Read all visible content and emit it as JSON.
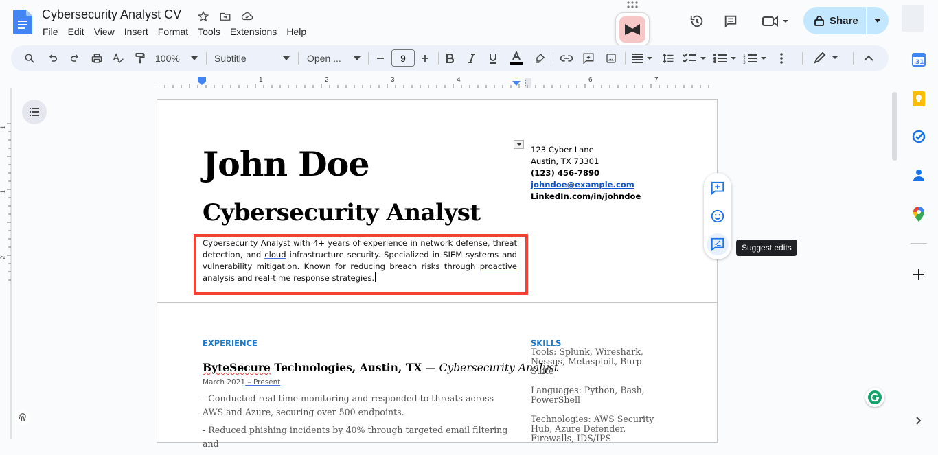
{
  "doc": {
    "title": "Cybersecurity Analyst CV",
    "menu": [
      "File",
      "Edit",
      "View",
      "Insert",
      "Format",
      "Tools",
      "Extensions",
      "Help"
    ]
  },
  "header": {
    "share_label": "Share"
  },
  "toolbar": {
    "zoom": "100%",
    "style": "Subtitle",
    "font": "Open ...",
    "font_size": "9"
  },
  "ruler": {
    "numbers": [
      "1",
      "2",
      "3",
      "4",
      "5",
      "6",
      "7"
    ]
  },
  "vruler": {
    "numbers": [
      "1",
      "1",
      "2"
    ]
  },
  "resume": {
    "name": "John Doe",
    "title": "Cybersecurity Analyst",
    "summary_parts": [
      "Cybersecurity Analyst with 4+ years of experience in network defense, threat detection, and ",
      "cloud",
      " infrastructure security. Specialized in SIEM systems and vulnerability mitigation. Known for reducing breach risks through ",
      "proactive",
      " analysis and real-time response strategies."
    ],
    "contact": {
      "address1": "123 Cyber Lane",
      "address2": "Austin, TX 73301",
      "phone": "(123) 456-7890",
      "email": "johndoe@example.com",
      "linkedin": "LinkedIn.com/in/johndoe"
    },
    "experience_heading": "EXPERIENCE",
    "job": {
      "company_a": "ByteSecure",
      "company_b": " Technologies, Austin, TX",
      "dash": " — ",
      "role": "Cybersecurity Analyst",
      "dates_a": "March 2021",
      "dates_b": " – Present",
      "bullets": [
        "- Conducted real-time monitoring and responded to threats across AWS and Azure, securing over 500 endpoints.",
        "- Reduced phishing incidents by 40% through targeted email filtering and"
      ]
    },
    "skills_heading": "SKILLS",
    "skills": [
      "Tools: Splunk, Wireshark, Nessus, Metasploit, Burp Suite",
      "Languages: Python, Bash, PowerShell",
      "Technologies: AWS Security Hub, Azure Defender, Firewalls, IDS/IPS"
    ]
  },
  "tooltip": "Suggest edits",
  "colors": {
    "accent": "#2079c7",
    "highlight_border": "#f44336",
    "share_bg": "#c2e7ff"
  }
}
